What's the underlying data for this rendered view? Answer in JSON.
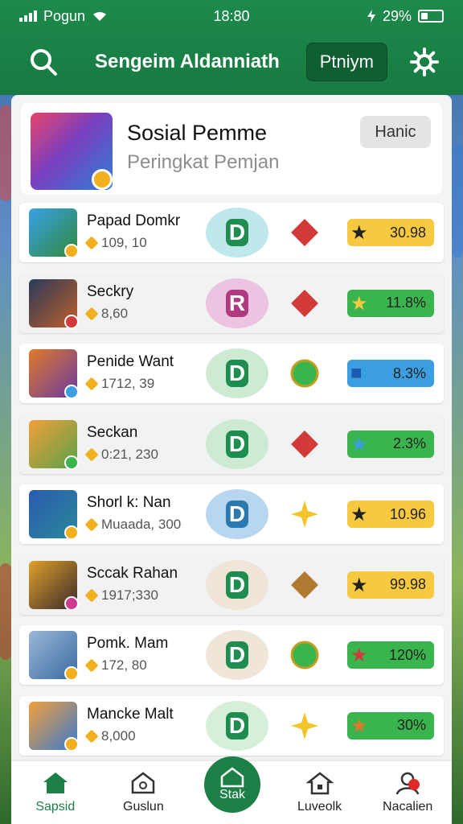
{
  "status": {
    "carrier": "Pogun",
    "time": "18:80",
    "battery": "29%"
  },
  "header": {
    "title": "Sengeim Aldanniath",
    "premium_label": "Ptniym"
  },
  "profile": {
    "name": "Sosial Pemme",
    "subtitle": "Peringkat Pemjan",
    "action_label": "Hanic"
  },
  "rows": [
    {
      "name": "Papad Domkr",
      "score": "109, 10",
      "pill": "30.98"
    },
    {
      "name": "Seckry",
      "score": "8,60",
      "pill": "11.8%"
    },
    {
      "name": "Penide Want",
      "score": "1712, 39",
      "pill": "8.3%"
    },
    {
      "name": "Seckan",
      "score": "0:21, 230",
      "pill": "2.3%"
    },
    {
      "name": "Shorl k: Nan",
      "score": "Muaada, 300",
      "pill": "10.96"
    },
    {
      "name": "Sccak Rahan",
      "score": "1917;330",
      "pill": "99.98"
    },
    {
      "name": "Pomk. Mam",
      "score": "172, 80",
      "pill": "120%"
    },
    {
      "name": "Mancke Malt",
      "score": "8,000",
      "pill": "30%"
    }
  ],
  "nav": {
    "home": "Sapsid",
    "guild": "Guslun",
    "center": "Stak",
    "live": "Luveolk",
    "profile": "Nacalien"
  },
  "icons": {
    "status": [
      "signal-icon",
      "wifi-icon",
      "battery-icon"
    ],
    "header": [
      "search-icon",
      "settings-gear-icon"
    ],
    "nav": [
      "home-icon",
      "guild-icon",
      "stack-icon",
      "house-icon",
      "user-icon"
    ]
  },
  "colors": {
    "brand_green": "#1b7f46",
    "gold": "#f7c940",
    "green_pill": "#3ab44c",
    "blue_pill": "#3a9ee0"
  }
}
